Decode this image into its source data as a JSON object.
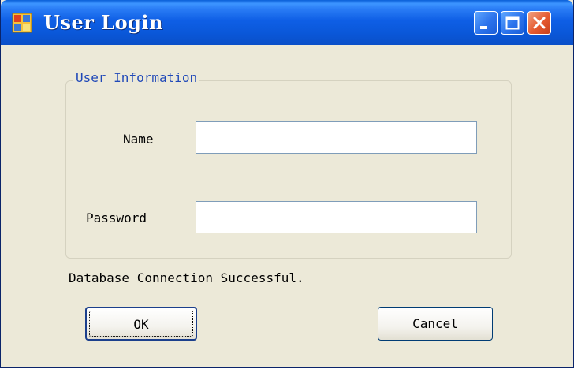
{
  "window": {
    "title": "User Login",
    "icon": "app-form-icon",
    "controls": [
      "minimize-icon",
      "maximize-icon",
      "close-icon"
    ],
    "colors": {
      "titlebar": "#0a57d8",
      "body": "#ece9d8",
      "close_button": "#e5592f"
    }
  },
  "group": {
    "legend": "User Information",
    "legend_color": "#1f48b8"
  },
  "form": {
    "name_label": "Name",
    "name_value": "",
    "password_label": "Password",
    "password_value": ""
  },
  "status": {
    "text": "Database Connection Successful."
  },
  "buttons": {
    "ok_label": "OK",
    "cancel_label": "Cancel"
  }
}
